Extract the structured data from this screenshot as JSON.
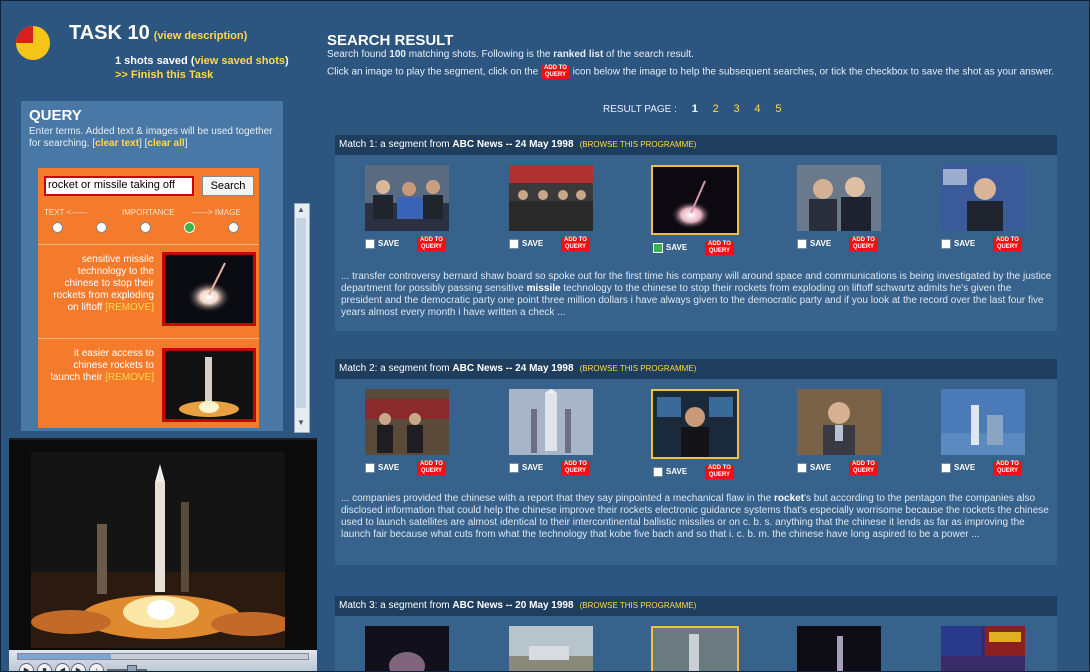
{
  "task": {
    "title": "TASK 10",
    "view_description": "(view description)",
    "saved_prefix": "1 shots saved (",
    "view_saved": "view saved shots",
    "saved_suffix": ")",
    "finish": ">> Finish this Task"
  },
  "query": {
    "heading": "QUERY",
    "desc_1": "Enter terms. Added text & images will be used together for searching. [",
    "clear_text": "clear text",
    "desc_2": "] [",
    "clear_all": "clear all",
    "desc_3": "]",
    "search_value": "rocket or missile taking off",
    "search_button": "Search",
    "scale_left": "TEXT <------",
    "scale_mid": "IMPORTANCE",
    "scale_right": "------> IMAGE",
    "importance_selected": 4,
    "items": [
      {
        "text": "sensitive missile technology to the chinese to stop their rockets from exploding on liftoff",
        "remove": "[REMOVE]"
      },
      {
        "text": "it easier access to chinese rockets to launch their",
        "remove": "[REMOVE]"
      }
    ]
  },
  "results": {
    "heading": "SEARCH RESULT",
    "line1_a": "Search found ",
    "line1_count": "100",
    "line1_b": " matching shots. Following is the ",
    "line1_ranked": "ranked list",
    "line1_c": " of the search result.",
    "line2_a": "Click an image to play the segment, click on the ",
    "line2_b": " icon below the image to help the subsequent searches, or tick the checkbox to save the shot as your answer.",
    "add_query_top": "ADD TO",
    "add_query_bottom": "QUERY",
    "save_label": "SAVE",
    "result_page_label": "RESULT PAGE :",
    "pages": [
      "1",
      "2",
      "3",
      "4",
      "5"
    ],
    "current_page": "1",
    "browse_label": "(BROWSE THIS PROGRAMME)",
    "matches": [
      {
        "prefix": "Match 1: a segment from ",
        "source": "ABC News -- 24 May 1998",
        "saved_index": 2,
        "transcript_a": "... transfer controversy bernard shaw board so spoke out for the first time his company will around space and communications is being investigated by the justice department for possibly passing sensitive ",
        "keyword": "missile",
        "transcript_b": " technology to the chinese to stop their rockets from exploding on liftoff schwartz admits he's given the president and the democratic party one point three million dollars i have always given to the democratic party and if you look at the record over the last four five years almost every month i have written a check ..."
      },
      {
        "prefix": "Match 2: a segment from ",
        "source": "ABC News -- 24 May 1998",
        "saved_index": -1,
        "transcript_a": "... companies provided the chinese with a report that they say pinpointed a mechanical flaw in the ",
        "keyword": "rocket",
        "transcript_b": "'s but according to the pentagon the companies also disclosed information that could help the chinese improve their rockets electronic guidance systems that's especially worrisome because the rockets the chinese used to launch satellites are almost identical to their intercontinental ballistic missiles or on c. b. s. anything that the chinese it lends as far as improving the launch fair because what cuts from what the technology that kobe five bach and so that i. c. b. m. the chinese have long aspired to be a power ..."
      },
      {
        "prefix": "Match 3: a segment from ",
        "source": "ABC News -- 20 May 1998",
        "saved_index": -1,
        "transcript_a": "",
        "keyword": "",
        "transcript_b": ""
      }
    ]
  },
  "colors": {
    "background": "#2c5580",
    "accent_link": "#ffd94a",
    "query_panel": "#f47b2c",
    "add_to_query": "#e11111",
    "checked": "#3ab34a"
  }
}
